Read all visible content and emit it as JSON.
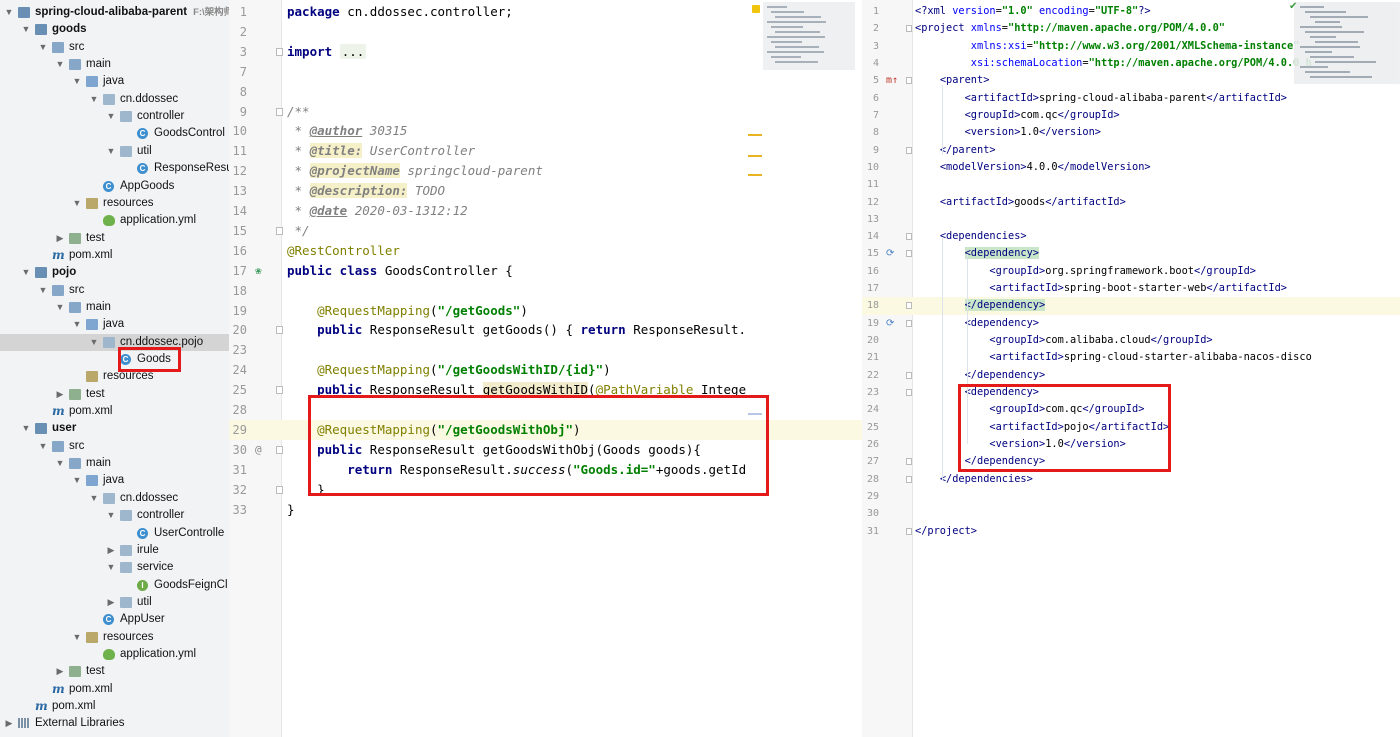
{
  "project_tree": {
    "items": [
      {
        "label": "spring-cloud-alibaba-parent",
        "path": "F:\\架构师",
        "icon": "module-folder-icon",
        "expanded": true,
        "bold": true
      },
      {
        "label": "goods",
        "icon": "module-folder-icon",
        "expanded": true,
        "bold": true
      },
      {
        "label": "src",
        "icon": "folder-icon",
        "expanded": true
      },
      {
        "label": "main",
        "icon": "folder-icon",
        "expanded": true
      },
      {
        "label": "java",
        "icon": "source-folder-icon",
        "expanded": true
      },
      {
        "label": "cn.ddossec",
        "icon": "package-icon",
        "expanded": true
      },
      {
        "label": "controller",
        "icon": "package-icon",
        "expanded": true
      },
      {
        "label": "GoodsControl",
        "icon": "class-icon"
      },
      {
        "label": "util",
        "icon": "package-icon",
        "expanded": true
      },
      {
        "label": "ResponseResu",
        "icon": "class-icon"
      },
      {
        "label": "AppGoods",
        "icon": "spring-boot-class-icon"
      },
      {
        "label": "resources",
        "icon": "resources-folder-icon",
        "expanded": true
      },
      {
        "label": "application.yml",
        "icon": "yaml-file-icon"
      },
      {
        "label": "test",
        "icon": "test-folder-icon",
        "expanded": false
      },
      {
        "label": "pom.xml",
        "icon": "maven-icon"
      },
      {
        "label": "pojo",
        "icon": "module-folder-icon",
        "expanded": true,
        "bold": true
      },
      {
        "label": "src",
        "icon": "folder-icon",
        "expanded": true
      },
      {
        "label": "main",
        "icon": "folder-icon",
        "expanded": true
      },
      {
        "label": "java",
        "icon": "source-folder-icon",
        "expanded": true
      },
      {
        "label": "cn.ddossec.pojo",
        "icon": "package-icon",
        "expanded": true,
        "selected": true
      },
      {
        "label": "Goods",
        "icon": "class-icon"
      },
      {
        "label": "resources",
        "icon": "resources-folder-icon"
      },
      {
        "label": "test",
        "icon": "test-folder-icon",
        "expanded": false
      },
      {
        "label": "pom.xml",
        "icon": "maven-icon"
      },
      {
        "label": "user",
        "icon": "module-folder-icon",
        "expanded": true,
        "bold": true
      },
      {
        "label": "src",
        "icon": "folder-icon",
        "expanded": true
      },
      {
        "label": "main",
        "icon": "folder-icon",
        "expanded": true
      },
      {
        "label": "java",
        "icon": "source-folder-icon",
        "expanded": true
      },
      {
        "label": "cn.ddossec",
        "icon": "package-icon",
        "expanded": true
      },
      {
        "label": "controller",
        "icon": "package-icon",
        "expanded": true
      },
      {
        "label": "UserControlle",
        "icon": "class-icon"
      },
      {
        "label": "irule",
        "icon": "package-icon",
        "expanded": false
      },
      {
        "label": "service",
        "icon": "package-icon",
        "expanded": true
      },
      {
        "label": "GoodsFeignCl",
        "icon": "interface-icon"
      },
      {
        "label": "util",
        "icon": "package-icon",
        "expanded": false
      },
      {
        "label": "AppUser",
        "icon": "spring-boot-class-icon"
      },
      {
        "label": "resources",
        "icon": "resources-folder-icon",
        "expanded": true
      },
      {
        "label": "application.yml",
        "icon": "yaml-file-icon"
      },
      {
        "label": "test",
        "icon": "test-folder-icon",
        "expanded": false
      },
      {
        "label": "pom.xml",
        "icon": "maven-icon"
      },
      {
        "label": "pom.xml",
        "icon": "maven-icon"
      },
      {
        "label": "External Libraries",
        "icon": "library-icon",
        "expanded": false
      }
    ]
  },
  "java_editor": {
    "lines": [
      {
        "num": "1",
        "html": "<span class=\"kw\">package</span> cn.ddossec.controller;"
      },
      {
        "num": "2",
        "html": ""
      },
      {
        "num": "3",
        "html": "<span class=\"kw\">import</span> <span class=\"fold\">...</span>",
        "fold": true
      },
      {
        "num": "7",
        "html": ""
      },
      {
        "num": "8",
        "html": ""
      },
      {
        "num": "9",
        "html": "<span class=\"cmt\">/**</span>",
        "fold": true
      },
      {
        "num": "10",
        "html": "<span class=\"cmt\"> * </span><span class=\"tag\">@author</span><span class=\"cmt\"> 30315</span>"
      },
      {
        "num": "11",
        "html": "<span class=\"cmt\"> * </span><span class=\"tagw\">@title:</span><span class=\"cmt\"> UserController</span>"
      },
      {
        "num": "12",
        "html": "<span class=\"cmt\"> * </span><span class=\"tagw\">@projectName</span><span class=\"cmt\"> springcloud-parent</span>"
      },
      {
        "num": "13",
        "html": "<span class=\"cmt\"> * </span><span class=\"tagw\">@description:</span><span class=\"cmt\"> TODO</span>"
      },
      {
        "num": "14",
        "html": "<span class=\"cmt\"> * </span><span class=\"tag\">@date</span><span class=\"cmt\"> 2020-03-1312:12</span>"
      },
      {
        "num": "15",
        "html": "<span class=\"cmt\"> */</span>",
        "fold": true
      },
      {
        "num": "16",
        "html": "<span class=\"ann\">@RestController</span>"
      },
      {
        "num": "17",
        "html": "<span class=\"kw\">public class</span> GoodsController {",
        "gicon": "spring-bean-icon"
      },
      {
        "num": "18",
        "html": ""
      },
      {
        "num": "19",
        "html": "    <span class=\"ann\">@RequestMapping</span>(<span class=\"str\">\"/getGoods\"</span>)"
      },
      {
        "num": "20",
        "html": "    <span class=\"kw\">public</span> ResponseResult getGoods() { <span class=\"kw\">return</span> ResponseResult.",
        "fold": true
      },
      {
        "num": "23",
        "html": ""
      },
      {
        "num": "24",
        "html": "    <span class=\"ann\">@RequestMapping</span>(<span class=\"str\">\"/getGoodsWithID/{id}\"</span>)"
      },
      {
        "num": "25",
        "html": "    <span class=\"kw\">public</span> ResponseResult <span class=\"ghl\">getGoodsWithID</span>(<span class=\"ann\">@PathVariable</span> Intege",
        "fold": true
      },
      {
        "num": "28",
        "html": ""
      },
      {
        "num": "29",
        "html": "    <span class=\"ann\">@RequestMapping</span>(<span class=\"str\">\"/getGoodsWithObj\"</span>)",
        "hl": true
      },
      {
        "num": "30",
        "html": "    <span class=\"kw\">public</span> ResponseResult getGoodsWithObj(Goods goods){",
        "gicon": "@",
        "fold": true
      },
      {
        "num": "31",
        "html": "        <span class=\"kw\">return</span> ResponseResult.<span class=\"it\">success</span>(<span class=\"str\">\"Goods.id=\"</span>+goods.getId"
      },
      {
        "num": "32",
        "html": "    }",
        "fold": true
      },
      {
        "num": "33",
        "html": "}"
      }
    ]
  },
  "xml_editor": {
    "lines": [
      {
        "num": "1",
        "html": "<span class=\"xt\">&lt;?xml </span><span class=\"xa\">version</span>=<span class=\"xv\">\"1.0\"</span> <span class=\"xa\">encoding</span>=<span class=\"xv\">\"UTF-8\"</span><span class=\"xt\">?&gt;</span>"
      },
      {
        "num": "2",
        "html": "<span class=\"xt\">&lt;project </span><span class=\"xa\">xmlns</span>=<span class=\"xv\">\"http://maven.apache.org/POM/4.0.0\"</span>",
        "fold": true
      },
      {
        "num": "3",
        "html": "         <span class=\"xa\">xmlns:xsi</span>=<span class=\"xv\">\"http://www.w3.org/2001/XMLSchema-instance\"</span>"
      },
      {
        "num": "4",
        "html": "         <span class=\"xa\">xsi:schemaLocation</span>=<span class=\"xv\">\"http://maven.apache.org/POM/4.0.0 h</span>"
      },
      {
        "num": "5",
        "html": "    <span class=\"xt\">&lt;parent&gt;</span>",
        "gicon": "m↑",
        "fold": true
      },
      {
        "num": "6",
        "html": "        <span class=\"xt\">&lt;artifactId&gt;</span>spring-cloud-alibaba-parent<span class=\"xt\">&lt;/artifactId&gt;</span>"
      },
      {
        "num": "7",
        "html": "        <span class=\"xt\">&lt;groupId&gt;</span>com.qc<span class=\"xt\">&lt;/groupId&gt;</span>"
      },
      {
        "num": "8",
        "html": "        <span class=\"xt\">&lt;version&gt;</span>1.0<span class=\"xt\">&lt;/version&gt;</span>"
      },
      {
        "num": "9",
        "html": "    <span class=\"xt\">&lt;/parent&gt;</span>",
        "fold": true
      },
      {
        "num": "10",
        "html": "    <span class=\"xt\">&lt;modelVersion&gt;</span>4.0.0<span class=\"xt\">&lt;/modelVersion&gt;</span>"
      },
      {
        "num": "11",
        "html": ""
      },
      {
        "num": "12",
        "html": "    <span class=\"xt\">&lt;artifactId&gt;</span>goods<span class=\"xt\">&lt;/artifactId&gt;</span>"
      },
      {
        "num": "13",
        "html": ""
      },
      {
        "num": "14",
        "html": "    <span class=\"xt\">&lt;dependencies&gt;</span>",
        "fold": true
      },
      {
        "num": "15",
        "html": "        <span class=\"xt xdep\">&lt;dependency&gt;</span>",
        "gicon": "⟳",
        "fold": true
      },
      {
        "num": "16",
        "html": "            <span class=\"xt\">&lt;groupId&gt;</span>org.springframework.boot<span class=\"xt\">&lt;/groupId&gt;</span>"
      },
      {
        "num": "17",
        "html": "            <span class=\"xt\">&lt;artifactId&gt;</span>spring-boot-starter-web<span class=\"xt\">&lt;/artifactId&gt;</span>"
      },
      {
        "num": "18",
        "html": "        <span class=\"xt xdep\">&lt;/dependency&gt;</span>",
        "hl": true,
        "fold": true
      },
      {
        "num": "19",
        "html": "        <span class=\"xt\">&lt;dependency&gt;</span>",
        "gicon": "⟳",
        "fold": true
      },
      {
        "num": "20",
        "html": "            <span class=\"xt\">&lt;groupId&gt;</span>com.alibaba.cloud<span class=\"xt\">&lt;/groupId&gt;</span>"
      },
      {
        "num": "21",
        "html": "            <span class=\"xt\">&lt;artifactId&gt;</span>spring-cloud-starter-alibaba-nacos-disco"
      },
      {
        "num": "22",
        "html": "        <span class=\"xt\">&lt;/dependency&gt;</span>",
        "fold": true
      },
      {
        "num": "23",
        "html": "        <span class=\"xt\">&lt;dependency&gt;</span>",
        "fold": true
      },
      {
        "num": "24",
        "html": "            <span class=\"xt\">&lt;groupId&gt;</span>com.qc<span class=\"xt\">&lt;/groupId&gt;</span>"
      },
      {
        "num": "25",
        "html": "            <span class=\"xt\">&lt;artifactId&gt;</span>pojo<span class=\"xt\">&lt;/artifactId&gt;</span>"
      },
      {
        "num": "26",
        "html": "            <span class=\"xt\">&lt;version&gt;</span>1.0<span class=\"xt\">&lt;/version&gt;</span>"
      },
      {
        "num": "27",
        "html": "        <span class=\"xt\">&lt;/dependency&gt;</span>",
        "fold": true
      },
      {
        "num": "28",
        "html": "    <span class=\"xt\">&lt;/dependencies&gt;</span>",
        "fold": true
      },
      {
        "num": "29",
        "html": ""
      },
      {
        "num": "30",
        "html": ""
      },
      {
        "num": "31",
        "html": "<span class=\"xt\">&lt;/project&gt;</span>",
        "fold": true
      }
    ]
  },
  "colors": {
    "annotation_box": "#e41a1a",
    "selection": "#d4d4d4",
    "caret_line": "#fcf9e2"
  }
}
